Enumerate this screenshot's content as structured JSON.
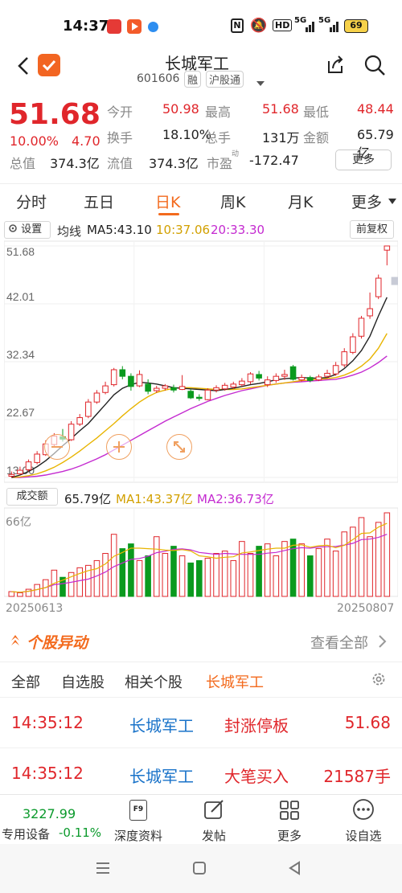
{
  "status_bar": {
    "time": "14:37",
    "battery": "69",
    "icons": [
      "calendar-app-icon",
      "video-app-icon",
      "app-icon",
      "nfc-icon",
      "mute-icon",
      "hd-icon",
      "5g-signal-icon",
      "5g-signal-icon",
      "battery-icon"
    ],
    "signal1": "5G",
    "signal2": "5G",
    "hd": "HD"
  },
  "header": {
    "title": "长城军工",
    "code": "601606",
    "tag_margin": "融",
    "tag_connect": "沪股通"
  },
  "quote": {
    "price": "51.68",
    "change_pct": "10.00%",
    "change": "4.70",
    "fields": [
      {
        "label": "今开",
        "value": "50.98",
        "color": "#e0262b"
      },
      {
        "label": "最高",
        "value": "51.68",
        "color": "#e0262b"
      },
      {
        "label": "最低",
        "value": "48.44",
        "color": "#e0262b"
      },
      {
        "label": "换手",
        "value": "18.10%",
        "color": "#222"
      },
      {
        "label": "总手",
        "value": "131万",
        "color": "#222"
      },
      {
        "label": "金额",
        "value": "65.79亿",
        "color": "#222"
      },
      {
        "label": "总值",
        "value": "374.3亿",
        "color": "#222"
      },
      {
        "label": "流值",
        "value": "374.3亿",
        "color": "#222"
      },
      {
        "label": "市盈",
        "value": "-172.47",
        "color": "#222"
      }
    ],
    "pe_sup": "动",
    "more_button": "更多"
  },
  "tabs": {
    "items": [
      "分时",
      "五日",
      "日K",
      "周K",
      "月K",
      "更多"
    ],
    "active": "日K"
  },
  "chart": {
    "settings_label": "设置",
    "ma_title": "均线",
    "ma5": "MA5:43.10",
    "ma10": "10:37.06",
    "ma20": "20:33.30",
    "fq_button": "前复权",
    "y_ticks": [
      "51.68",
      "42.01",
      "32.34",
      "22.67",
      "13.00"
    ],
    "vol_label": "成交额",
    "vol_value": "65.79亿",
    "vol_ma1": "MA1:43.37亿",
    "vol_ma2": "MA2:36.73亿",
    "vol_top": "66亿",
    "date_start": "20250613",
    "date_end": "20250807",
    "colors": {
      "up": "#e0262b",
      "down": "#0a9a1e",
      "ma5": "#222222",
      "ma10": "#e8b400",
      "ma20": "#c42ad0"
    }
  },
  "chart_data": {
    "type": "candlestick",
    "ylim": [
      13.0,
      51.68
    ],
    "candles": [
      {
        "o": 13.2,
        "c": 13.5,
        "h": 14.0,
        "l": 13.0
      },
      {
        "o": 13.6,
        "c": 14.2,
        "h": 14.8,
        "l": 13.4
      },
      {
        "o": 14.3,
        "c": 15.6,
        "h": 16.0,
        "l": 14.0
      },
      {
        "o": 15.5,
        "c": 16.9,
        "h": 17.4,
        "l": 15.2
      },
      {
        "o": 16.8,
        "c": 18.6,
        "h": 19.2,
        "l": 16.6
      },
      {
        "o": 18.5,
        "c": 19.9,
        "h": 20.4,
        "l": 18.0
      },
      {
        "o": 19.8,
        "c": 19.4,
        "h": 21.1,
        "l": 19.0
      },
      {
        "o": 19.3,
        "c": 21.9,
        "h": 22.4,
        "l": 19.1
      },
      {
        "o": 21.9,
        "c": 23.0,
        "h": 23.6,
        "l": 21.6
      },
      {
        "o": 23.2,
        "c": 25.6,
        "h": 26.1,
        "l": 22.9
      },
      {
        "o": 25.6,
        "c": 27.1,
        "h": 27.6,
        "l": 25.3
      },
      {
        "o": 27.2,
        "c": 28.3,
        "h": 29.0,
        "l": 26.9
      },
      {
        "o": 28.5,
        "c": 31.0,
        "h": 31.3,
        "l": 28.2
      },
      {
        "o": 31.0,
        "c": 29.9,
        "h": 31.6,
        "l": 29.4
      },
      {
        "o": 29.9,
        "c": 28.2,
        "h": 30.4,
        "l": 27.5
      },
      {
        "o": 28.3,
        "c": 30.2,
        "h": 30.9,
        "l": 28.1
      },
      {
        "o": 28.6,
        "c": 27.4,
        "h": 29.4,
        "l": 26.9
      },
      {
        "o": 27.5,
        "c": 27.9,
        "h": 28.3,
        "l": 27.1
      },
      {
        "o": 27.9,
        "c": 28.3,
        "h": 28.6,
        "l": 27.5
      },
      {
        "o": 28.0,
        "c": 27.6,
        "h": 28.5,
        "l": 27.2
      },
      {
        "o": 27.7,
        "c": 28.2,
        "h": 30.1,
        "l": 27.6
      },
      {
        "o": 27.4,
        "c": 26.3,
        "h": 27.8,
        "l": 26.1
      },
      {
        "o": 26.4,
        "c": 26.2,
        "h": 26.9,
        "l": 25.8
      },
      {
        "o": 26.0,
        "c": 27.6,
        "h": 27.9,
        "l": 25.9
      },
      {
        "o": 27.6,
        "c": 28.0,
        "h": 28.4,
        "l": 27.2
      },
      {
        "o": 27.8,
        "c": 28.4,
        "h": 28.8,
        "l": 27.5
      },
      {
        "o": 28.1,
        "c": 28.6,
        "h": 29.0,
        "l": 27.8
      },
      {
        "o": 28.5,
        "c": 29.1,
        "h": 29.6,
        "l": 28.2
      },
      {
        "o": 29.0,
        "c": 30.3,
        "h": 30.6,
        "l": 28.6
      },
      {
        "o": 30.2,
        "c": 29.6,
        "h": 30.8,
        "l": 29.2
      },
      {
        "o": 28.5,
        "c": 29.3,
        "h": 29.9,
        "l": 28.1
      },
      {
        "o": 29.2,
        "c": 29.9,
        "h": 30.4,
        "l": 28.8
      },
      {
        "o": 29.9,
        "c": 30.2,
        "h": 31.0,
        "l": 29.3
      },
      {
        "o": 31.5,
        "c": 29.4,
        "h": 31.8,
        "l": 29.2
      },
      {
        "o": 29.3,
        "c": 29.7,
        "h": 30.2,
        "l": 29.0
      },
      {
        "o": 29.7,
        "c": 29.2,
        "h": 30.0,
        "l": 28.9
      },
      {
        "o": 29.3,
        "c": 29.8,
        "h": 30.2,
        "l": 29.1
      },
      {
        "o": 29.9,
        "c": 30.4,
        "h": 31.0,
        "l": 29.5
      },
      {
        "o": 30.3,
        "c": 31.7,
        "h": 32.3,
        "l": 30.0
      },
      {
        "o": 31.8,
        "c": 34.0,
        "h": 34.6,
        "l": 31.4
      },
      {
        "o": 33.9,
        "c": 36.5,
        "h": 37.1,
        "l": 33.6
      },
      {
        "o": 36.6,
        "c": 39.6,
        "h": 40.0,
        "l": 36.2
      },
      {
        "o": 40.0,
        "c": 41.2,
        "h": 43.9,
        "l": 39.5
      },
      {
        "o": 43.2,
        "c": 46.3,
        "h": 46.9,
        "l": 42.8
      },
      {
        "o": 50.98,
        "c": 51.68,
        "h": 51.68,
        "l": 48.44
      }
    ],
    "ma5_path": [
      13.0,
      13.4,
      14.0,
      14.8,
      15.8,
      17.0,
      18.3,
      19.5,
      20.8,
      22.0,
      23.6,
      25.2,
      26.8,
      27.9,
      28.5,
      28.9,
      28.8,
      28.6,
      28.3,
      28.0,
      27.9,
      27.8,
      27.7,
      27.6,
      27.5,
      27.7,
      27.9,
      28.2,
      28.5,
      28.7,
      29.0,
      29.3,
      29.5,
      29.6,
      29.7,
      29.6,
      29.6,
      29.7,
      30.2,
      31.2,
      32.5,
      34.2,
      36.6,
      40.0,
      43.1
    ],
    "ma10_path": [
      13.0,
      13.1,
      13.3,
      13.6,
      14.1,
      14.7,
      15.5,
      16.4,
      17.4,
      18.5,
      19.6,
      20.8,
      22.0,
      23.3,
      24.5,
      25.6,
      26.5,
      27.2,
      27.6,
      27.9,
      28.0,
      28.0,
      27.9,
      27.8,
      27.7,
      27.7,
      27.7,
      27.8,
      28.0,
      28.2,
      28.4,
      28.6,
      28.8,
      29.0,
      29.2,
      29.3,
      29.4,
      29.5,
      29.7,
      30.1,
      30.7,
      31.6,
      32.8,
      34.6,
      37.06
    ],
    "ma20_path": [
      13.0,
      13.0,
      13.1,
      13.2,
      13.4,
      13.7,
      14.0,
      14.4,
      14.9,
      15.5,
      16.1,
      16.8,
      17.6,
      18.4,
      19.2,
      20.0,
      20.8,
      21.6,
      22.4,
      23.1,
      23.8,
      24.5,
      25.1,
      25.7,
      26.2,
      26.7,
      27.1,
      27.5,
      27.8,
      28.1,
      28.4,
      28.6,
      28.8,
      28.9,
      29.0,
      29.1,
      29.2,
      29.3,
      29.4,
      29.7,
      30.1,
      30.6,
      31.3,
      32.2,
      33.3
    ],
    "volumes": [
      4,
      3,
      6,
      10,
      14,
      22,
      16,
      20,
      24,
      26,
      30,
      36,
      52,
      40,
      44,
      30,
      34,
      50,
      36,
      42,
      34,
      28,
      30,
      32,
      36,
      38,
      30,
      46,
      36,
      42,
      44,
      34,
      46,
      48,
      44,
      34,
      40,
      48,
      38,
      54,
      58,
      66,
      50,
      62,
      70
    ],
    "vol_ylim": [
      0,
      70
    ]
  },
  "movement": {
    "title": "个股异动",
    "view_all": "查看全部"
  },
  "filters": {
    "items": [
      "全部",
      "自选股",
      "相关个股",
      "长城军工"
    ],
    "active": "长城军工"
  },
  "events": [
    {
      "time": "14:35:12",
      "name": "长城军工",
      "type": "封涨停板",
      "value": "51.68"
    },
    {
      "time": "14:35:12",
      "name": "长城军工",
      "type": "大笔买入",
      "value": "21587手"
    }
  ],
  "bottom_nav": {
    "index_value": "3227.99",
    "index_label": "专用设备",
    "index_change": "-0.11%",
    "items": [
      "深度资料",
      "发帖",
      "更多",
      "设自选"
    ]
  }
}
